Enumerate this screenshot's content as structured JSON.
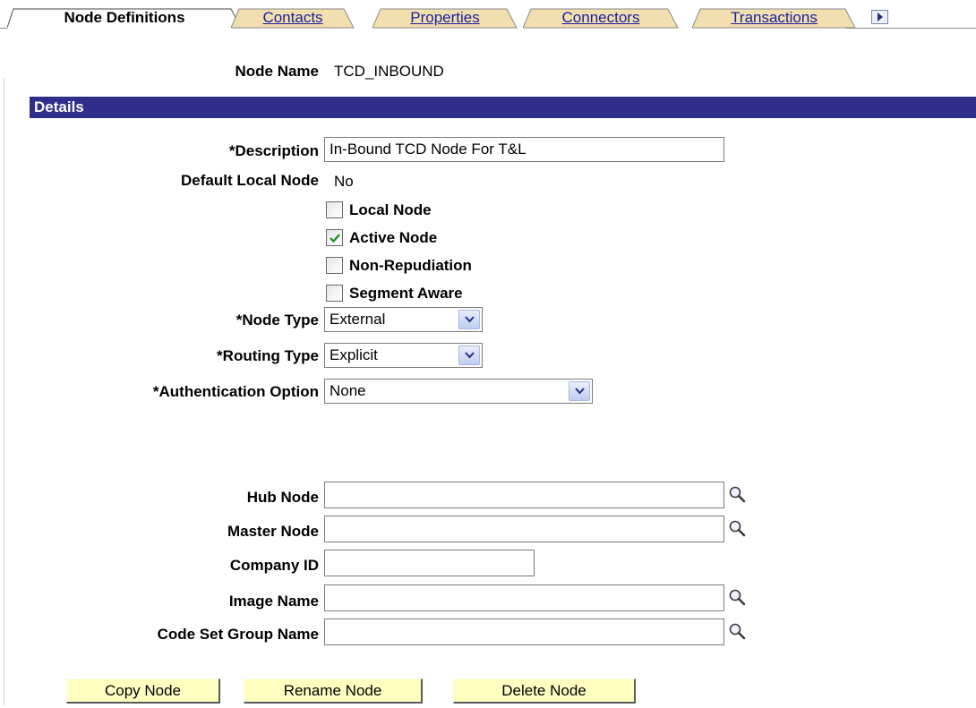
{
  "tabs": [
    {
      "label": "Node Definitions",
      "active": true
    },
    {
      "label": "Contacts",
      "active": false
    },
    {
      "label": "Properties",
      "active": false
    },
    {
      "label": "Connectors",
      "active": false
    },
    {
      "label": "Transactions",
      "active": false
    }
  ],
  "node_name": {
    "label": "Node Name",
    "value": "TCD_INBOUND"
  },
  "section_title": "Details",
  "description": {
    "label": "*Description",
    "value": "In-Bound TCD Node For T&L"
  },
  "default_local_node": {
    "label": "Default Local Node",
    "value": "No"
  },
  "checkboxes": [
    {
      "label": "Local Node",
      "checked": false
    },
    {
      "label": "Active Node",
      "checked": true
    },
    {
      "label": "Non-Repudiation",
      "checked": false
    },
    {
      "label": "Segment Aware",
      "checked": false
    }
  ],
  "node_type": {
    "label": "*Node Type",
    "value": "External"
  },
  "routing_type": {
    "label": "*Routing Type",
    "value": "Explicit"
  },
  "authentication_option": {
    "label": "*Authentication Option",
    "value": "None"
  },
  "hub_node": {
    "label": "Hub Node",
    "value": ""
  },
  "master_node": {
    "label": "Master Node",
    "value": ""
  },
  "company_id": {
    "label": "Company ID",
    "value": ""
  },
  "image_name": {
    "label": "Image Name",
    "value": ""
  },
  "code_set_group_name": {
    "label": "Code Set Group Name",
    "value": ""
  },
  "buttons": {
    "copy": "Copy Node",
    "rename": "Rename Node",
    "delete": "Delete Node"
  },
  "colors": {
    "section_bar": "#2f2f8b",
    "tab_inactive": "#f1dfb0",
    "button_bg": "#ffffc0",
    "link": "#1b1f9a",
    "check": "#1e8c1e"
  }
}
